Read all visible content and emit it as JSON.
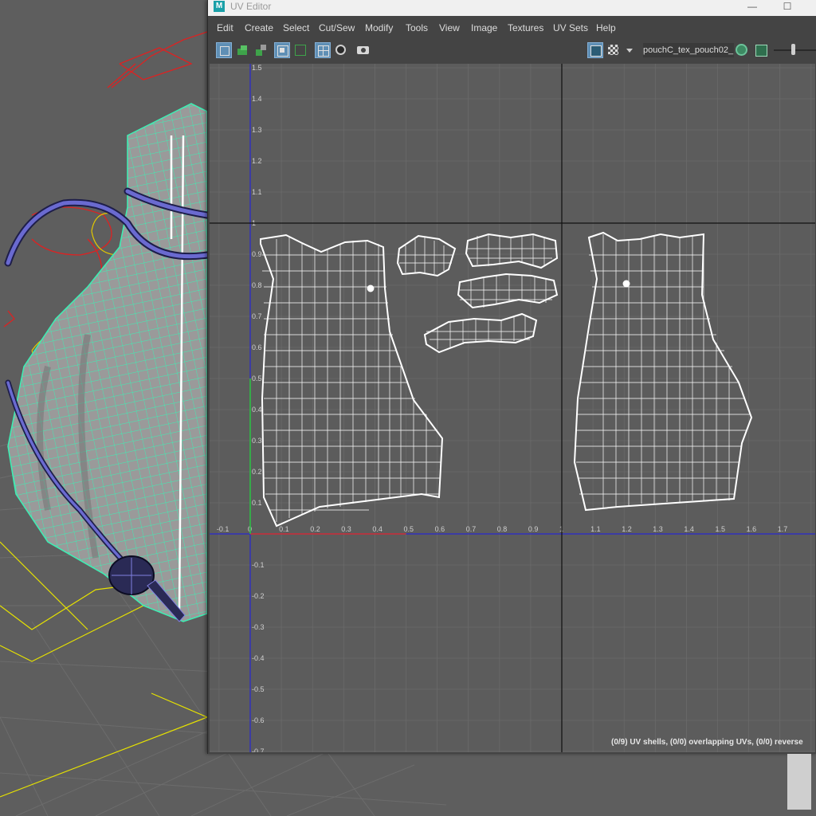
{
  "window": {
    "title": "UV Editor",
    "minimize_glyph": "—",
    "maximize_glyph": "☐"
  },
  "menu": [
    "Edit",
    "Create",
    "Select",
    "Cut/Sew",
    "Modify",
    "Tools",
    "View",
    "Image",
    "Textures",
    "UV Sets",
    "Help"
  ],
  "toolbar": {
    "texture_name": "pouchC_tex_pouch02_",
    "icons": [
      "uv-shell-icon",
      "uv-shell-alt-icon",
      "uv-vertex-icon",
      "frame-icon",
      "frame-alt-icon",
      "grid-icon",
      "shaded-icon",
      "snapshot-icon",
      "display-image-icon",
      "checker-icon",
      "dropdown-icon",
      "texture-icon",
      "image-icon"
    ]
  },
  "uv_axes": {
    "u_ticks": [
      "-0.1",
      "0",
      "0.1",
      "0.2",
      "0.3",
      "0.4",
      "0.5",
      "0.6",
      "0.7",
      "0.8",
      "0.9",
      "1",
      "1.1",
      "1.2",
      "1.3",
      "1.4",
      "1.5",
      "1.6",
      "1.7"
    ],
    "v_ticks": [
      "1.5",
      "1.4",
      "1.3",
      "1.2",
      "1.1",
      "1",
      "0.9",
      "0.8",
      "0.7",
      "0.6",
      "0.5",
      "0.4",
      "0.3",
      "0.2",
      "0.1",
      "-0.1",
      "-0.2",
      "-0.3",
      "-0.4",
      "-0.5",
      "-0.6",
      "-0.7"
    ],
    "u_range": [
      -0.12,
      1.8
    ],
    "v_range": [
      -0.7,
      1.5
    ]
  },
  "status": "(0/9) UV shells, (0/0) overlapping UVs, (0/0) reverse",
  "colors": {
    "panel_bg": "#444444",
    "canvas_bg": "#5c5c5c",
    "uv_wire": "#ffffff",
    "scene_wire": "#3cf0b4",
    "u_axis": "#d03030",
    "v_axis": "#2828d0",
    "highlight_blue": "#5f8fb5"
  }
}
